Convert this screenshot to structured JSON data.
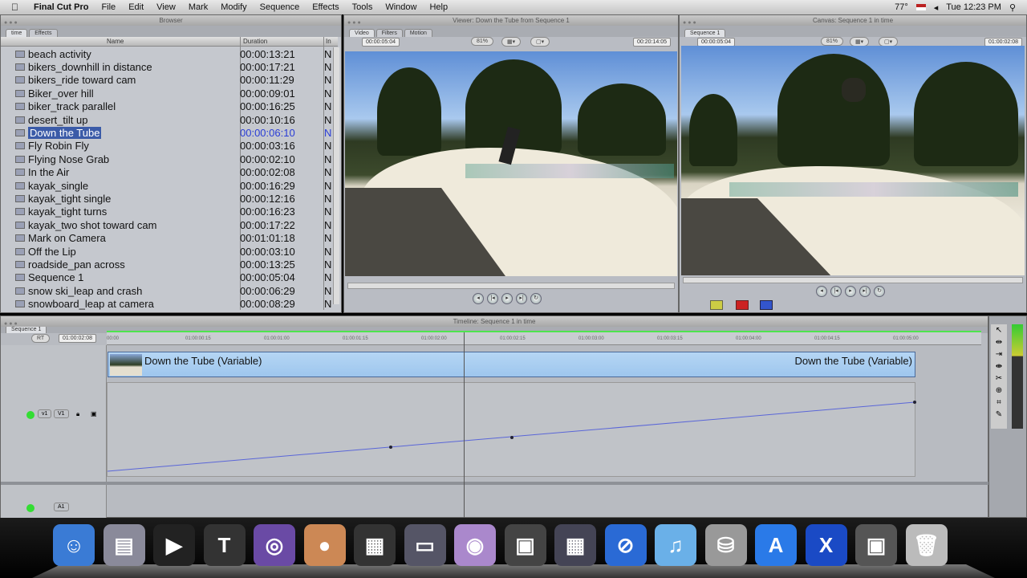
{
  "menubar": {
    "app": "Final Cut Pro",
    "items": [
      "File",
      "Edit",
      "View",
      "Mark",
      "Modify",
      "Sequence",
      "Effects",
      "Tools",
      "Window",
      "Help"
    ],
    "status": {
      "temp": "77°",
      "clock": "Tue 12:23 PM"
    }
  },
  "browser": {
    "title": "Browser",
    "tabs": [
      "time",
      "Effects"
    ],
    "columns": {
      "name": "Name",
      "duration": "Duration",
      "in": "In"
    },
    "rows": [
      {
        "name": "beach activity",
        "duration": "00:00:13:21",
        "in": "N"
      },
      {
        "name": "bikers_downhill in distance",
        "duration": "00:00:17:21",
        "in": "N"
      },
      {
        "name": "bikers_ride toward cam",
        "duration": "00:00:11:29",
        "in": "N"
      },
      {
        "name": "Biker_over hill",
        "duration": "00:00:09:01",
        "in": "N"
      },
      {
        "name": "biker_track parallel",
        "duration": "00:00:16:25",
        "in": "N"
      },
      {
        "name": "desert_tilt up",
        "duration": "00:00:10:16",
        "in": "N"
      },
      {
        "name": "Down the Tube",
        "duration": "00:00:06:10",
        "in": "N",
        "selected": true
      },
      {
        "name": "Fly Robin Fly",
        "duration": "00:00:03:16",
        "in": "N"
      },
      {
        "name": "Flying Nose Grab",
        "duration": "00:00:02:10",
        "in": "N"
      },
      {
        "name": "In the Air",
        "duration": "00:00:02:08",
        "in": "N"
      },
      {
        "name": "kayak_single",
        "duration": "00:00:16:29",
        "in": "N"
      },
      {
        "name": "kayak_tight single",
        "duration": "00:00:12:16",
        "in": "N"
      },
      {
        "name": "kayak_tight turns",
        "duration": "00:00:16:23",
        "in": "N"
      },
      {
        "name": "kayak_two shot toward cam",
        "duration": "00:00:17:22",
        "in": "N"
      },
      {
        "name": "Mark on Camera",
        "duration": "00:01:01:18",
        "in": "N"
      },
      {
        "name": "Off the Lip",
        "duration": "00:00:03:10",
        "in": "N"
      },
      {
        "name": "roadside_pan across",
        "duration": "00:00:13:25",
        "in": "N"
      },
      {
        "name": "Sequence 1",
        "duration": "00:00:05:04",
        "in": "N"
      },
      {
        "name": "snow ski_leap and crash",
        "duration": "00:00:06:29",
        "in": "N"
      },
      {
        "name": "snowboard_leap at camera",
        "duration": "00:00:08:29",
        "in": "N"
      }
    ]
  },
  "viewer": {
    "title": "Viewer: Down the Tube from Sequence 1",
    "tabs": [
      "Video",
      "Filters",
      "Motion"
    ],
    "duration": "00:00:05:04",
    "zoom": "81%",
    "timecode": "00:20:14:05"
  },
  "canvas": {
    "title": "Canvas: Sequence 1 in time",
    "tabs": [
      "Sequence 1"
    ],
    "duration": "00:00:05:04",
    "zoom": "81%",
    "timecode": "01:00:02:08"
  },
  "timeline": {
    "title": "Timeline: Sequence 1 in time",
    "tabs": [
      "Sequence 1"
    ],
    "rt": "RT",
    "timecode": "01:00:02:08",
    "ruler": [
      "00:00",
      "01:00:00:15",
      "01:00:01:00",
      "01:00:01:15",
      "01:00:02:00",
      "01:00:02:15",
      "01:00:03:00",
      "01:00:03:15",
      "01:00:04:00",
      "01:00:04:15",
      "01:00:05:00"
    ],
    "clip_label": "Down the Tube (Variable)",
    "track_v": "v1",
    "track_v2": "V1",
    "track_a": "A1"
  },
  "dock": {
    "icons": [
      "finder",
      "preview",
      "final-cut-pro",
      "keynote-t",
      "motion",
      "color",
      "clapper",
      "dvd-studio",
      "dvd-player",
      "photo-booth",
      "compressor",
      "safari",
      "itunes",
      "disk-utility",
      "app-store",
      "x11",
      "photo",
      "trash"
    ]
  }
}
